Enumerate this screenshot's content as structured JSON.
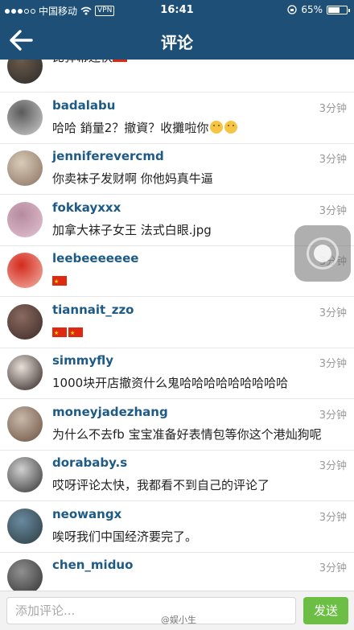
{
  "status_bar": {
    "carrier": "中国移动",
    "vpn": "VPN",
    "time": "16:41",
    "battery": "65%",
    "battery_level": 0.65
  },
  "header": {
    "title": "评论"
  },
  "comments": [
    {
      "username": "",
      "time": "",
      "text": "比弹幕还快",
      "flags": 1,
      "emojis": 0,
      "avatar_colors": [
        "#6a5a4a",
        "#2a2a2a"
      ]
    },
    {
      "username": "badalabu",
      "time": "3分钟",
      "text": "哈哈 銷量2？撤資？收攤啦你",
      "flags": 0,
      "emojis": 2,
      "avatar_colors": [
        "#5a5a5a",
        "#cfcfcf"
      ]
    },
    {
      "username": "jenniferevercmd",
      "time": "3分钟",
      "text": "你卖袜子发财啊 你他妈真牛逼",
      "flags": 0,
      "emojis": 0,
      "avatar_colors": [
        "#d9cbb8",
        "#8a7060"
      ]
    },
    {
      "username": "fokkayxxx",
      "time": "3分钟",
      "text": "加拿大袜子女王 法式白眼.jpg",
      "flags": 0,
      "emojis": 0,
      "avatar_colors": [
        "#b58aa0",
        "#e4c3d0"
      ]
    },
    {
      "username": "leebeeeeeee",
      "time": "3分钟",
      "text": "",
      "flags": 1,
      "emojis": 0,
      "avatar_colors": [
        "#d42a1e",
        "#f2b5a8"
      ]
    },
    {
      "username": "tiannait_zzo",
      "time": "3分钟",
      "text": "",
      "flags": 2,
      "emojis": 0,
      "avatar_colors": [
        "#8a6a60",
        "#3a2a25"
      ]
    },
    {
      "username": "simmyfly",
      "time": "3分钟",
      "text": "1000块开店撤资什么鬼哈哈哈哈哈哈哈哈哈",
      "flags": 0,
      "emojis": 0,
      "avatar_colors": [
        "#e8e0d8",
        "#2a2020"
      ]
    },
    {
      "username": "moneyjadezhang",
      "time": "3分钟",
      "text": "为什么不去fb 宝宝准备好表情包等你这个港灿狗呢",
      "flags": 0,
      "emojis": 0,
      "avatar_colors": [
        "#c8b8a8",
        "#6a5040"
      ]
    },
    {
      "username": "dorababy.s",
      "time": "3分钟",
      "text": "哎呀评论太快，我都看不到自己的评论了",
      "flags": 0,
      "emojis": 0,
      "avatar_colors": [
        "#d0d0d0",
        "#303030"
      ]
    },
    {
      "username": "neowangx",
      "time": "3分钟",
      "text": "唉呀我们中国经济要完了。",
      "flags": 0,
      "emojis": 0,
      "avatar_colors": [
        "#6a8aa0",
        "#2a3a40"
      ]
    },
    {
      "username": "chen_miduo",
      "time": "3分钟",
      "text": "",
      "flags": 0,
      "emojis": 0,
      "avatar_colors": [
        "#909090",
        "#303030"
      ]
    }
  ],
  "input": {
    "placeholder": "添加评论..."
  },
  "send_label": "发送",
  "watermark": "@娱小生",
  "colors": {
    "nav_bg": "#1d4f77",
    "username": "#1d5a86",
    "send_button": "#6cbe45"
  }
}
